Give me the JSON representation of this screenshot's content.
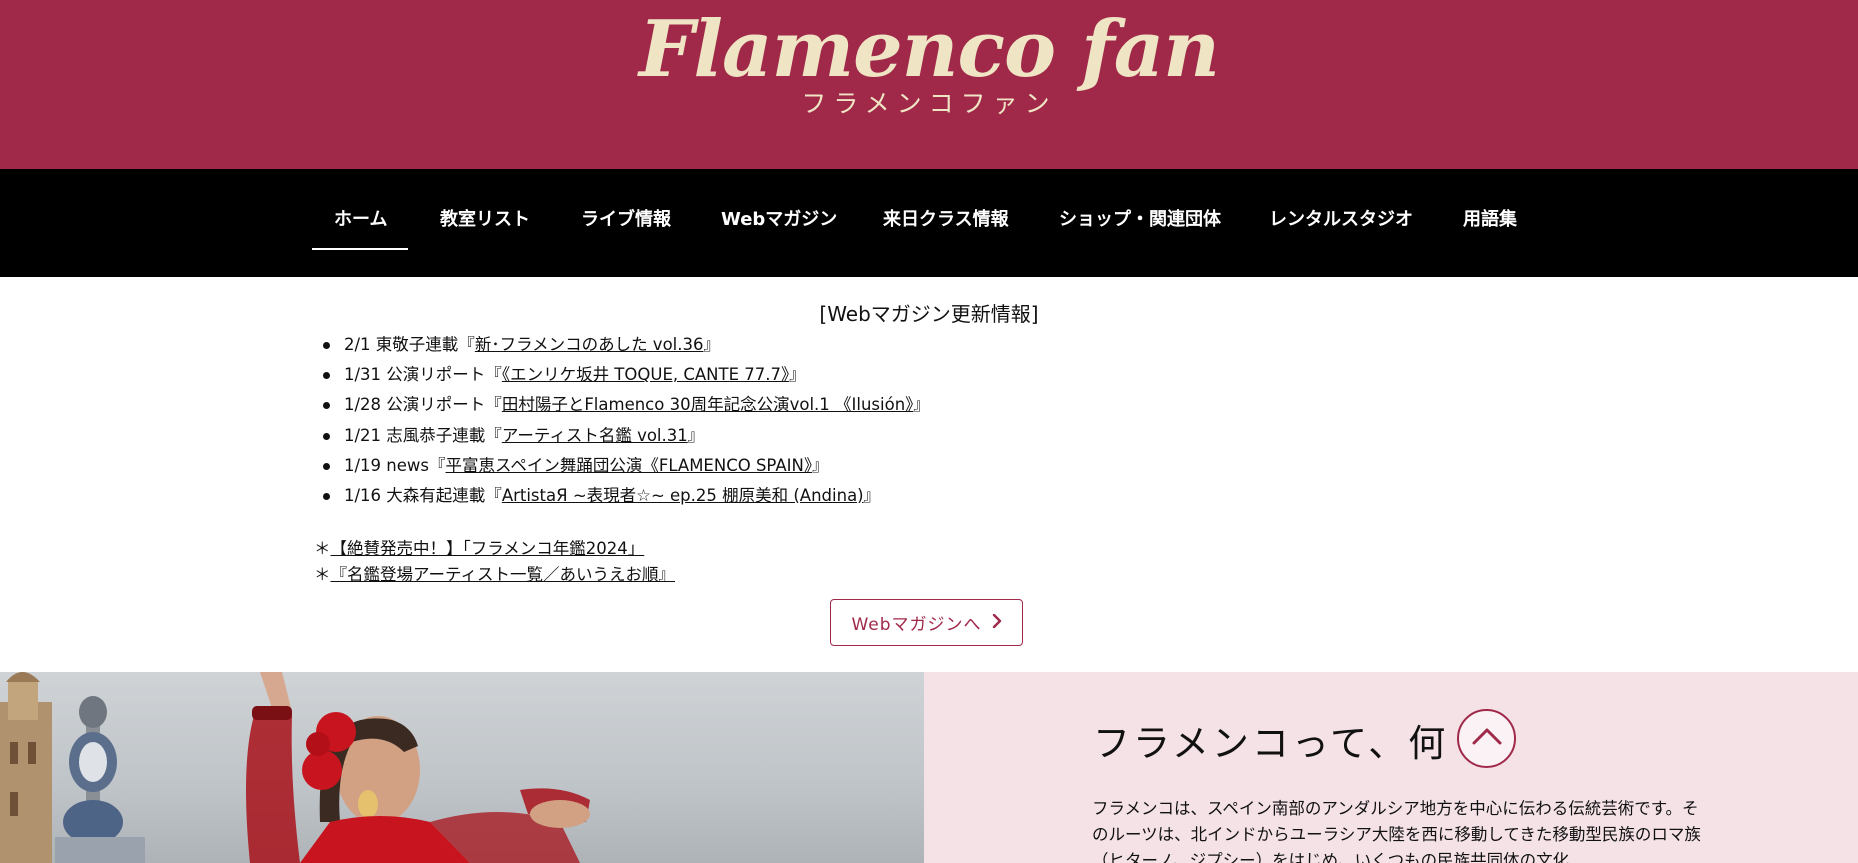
{
  "header": {
    "logo_title": "Flamenco fan",
    "logo_subtitle": "フラメンコファン"
  },
  "nav": {
    "items": [
      {
        "label": "ホーム",
        "active": true
      },
      {
        "label": "教室リスト"
      },
      {
        "label": "ライブ情報"
      },
      {
        "label": "Webマガジン"
      },
      {
        "label": "来日クラス情報"
      },
      {
        "label": "ショップ・関連団体"
      },
      {
        "label": "レンタルスタジオ"
      },
      {
        "label": "用語集"
      }
    ]
  },
  "updates": {
    "heading": "[Webマガジン更新情報]",
    "items": [
      {
        "prefix": "2/1 東敬子連載『",
        "link": "新･フラメンコのあした vol.36",
        "suffix": "』"
      },
      {
        "prefix": "1/31 公演リポート『",
        "link": "《エンリケ坂井 TOQUE, CANTE 77.7》",
        "suffix": "』"
      },
      {
        "prefix": "1/28 公演リポート『",
        "link": "田村陽子とFlamenco 30周年記念公演vol.1 《Ilusión》",
        "suffix": "』"
      },
      {
        "prefix": "1/21 志風恭子連載『",
        "link": "アーティスト名鑑 vol.31",
        "suffix": "』"
      },
      {
        "prefix": "1/19 news『",
        "link": "平富恵スペイン舞踊団公演《FLAMENCO SPAIN》",
        "suffix": "』"
      },
      {
        "prefix": "1/16 大森有起連載『",
        "link": "ArtistaЯ ~表現者☆~ ep.25 棚原美和 (Andina)",
        "suffix": "』"
      }
    ],
    "links": [
      {
        "star": "＊",
        "text": "【絶賛発売中！】「フラメンコ年鑑2024」"
      },
      {
        "star": "＊",
        "text": "『名鑑登場アーティスト一覧／あいうえお順』"
      }
    ],
    "button_label": "Webマガジンへ"
  },
  "about": {
    "title": "フラメンコって、何",
    "text": "フラメンコは、スペイン南部のアンダルシア地方を中心に伝わる伝統芸術です。そのルーツは、北インドからユーラシア大陸を西に移動してきた移動型民族のロマ族（ヒターノ、ジプシー）をはじめ、いくつもの民族共同体の文化"
  },
  "colors": {
    "brand": "#a0294a",
    "logo_text": "#efe4c4",
    "nav_bg": "#000000",
    "about_bg": "#f4e2e7",
    "dress_red": "#c8141e"
  },
  "icons": {
    "button_chevron": "chevron-right-icon",
    "scroll_top": "chevron-up-icon"
  }
}
